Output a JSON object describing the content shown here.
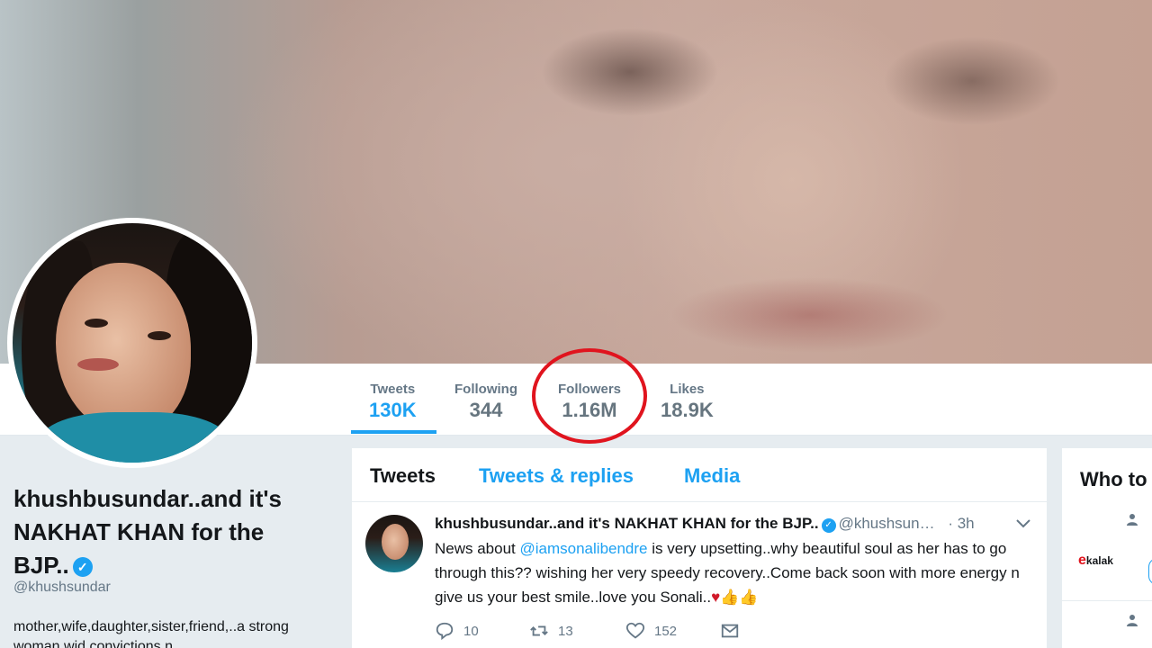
{
  "profile": {
    "name": "khushbusundar..and it's NAKHAT KHAN for the BJP..",
    "handle": "@khushsundar",
    "bio": "mother,wife,daughter,sister,friend,..a strong woman wid convictions n"
  },
  "stats": [
    {
      "label": "Tweets",
      "value": "130K"
    },
    {
      "label": "Following",
      "value": "344"
    },
    {
      "label": "Followers",
      "value": "1.16M"
    },
    {
      "label": "Likes",
      "value": "18.9K"
    }
  ],
  "timeline": {
    "tabs": [
      "Tweets",
      "Tweets & replies",
      "Media"
    ]
  },
  "tweet": {
    "name": "khushbusundar..and it's NAKHAT KHAN for the BJP..",
    "handle": "@khushsun…",
    "time": "3h",
    "text_before": "News about ",
    "mention": "@iamsonalibendre",
    "text_after": " is very upsetting..why beautiful soul as her has to go through this?? wishing her very speedy recovery..Come back soon with more energy n give us your best smile..love you Sonali..",
    "reply_count": "10",
    "retweet_count": "13",
    "like_count": "152"
  },
  "who_to_follow": {
    "title": "Who to"
  },
  "colors": {
    "accent": "#1da1f2",
    "highlight_circle": "#e0141e",
    "text_primary": "#14171a",
    "text_secondary": "#657786",
    "page_background": "#e6ecf0"
  },
  "icons": [
    "verified-badge-icon",
    "caret-down-icon",
    "reply-icon",
    "retweet-icon",
    "like-icon",
    "direct-message-icon",
    "person-icon",
    "heart-emoji",
    "thumbs-up-emoji"
  ]
}
